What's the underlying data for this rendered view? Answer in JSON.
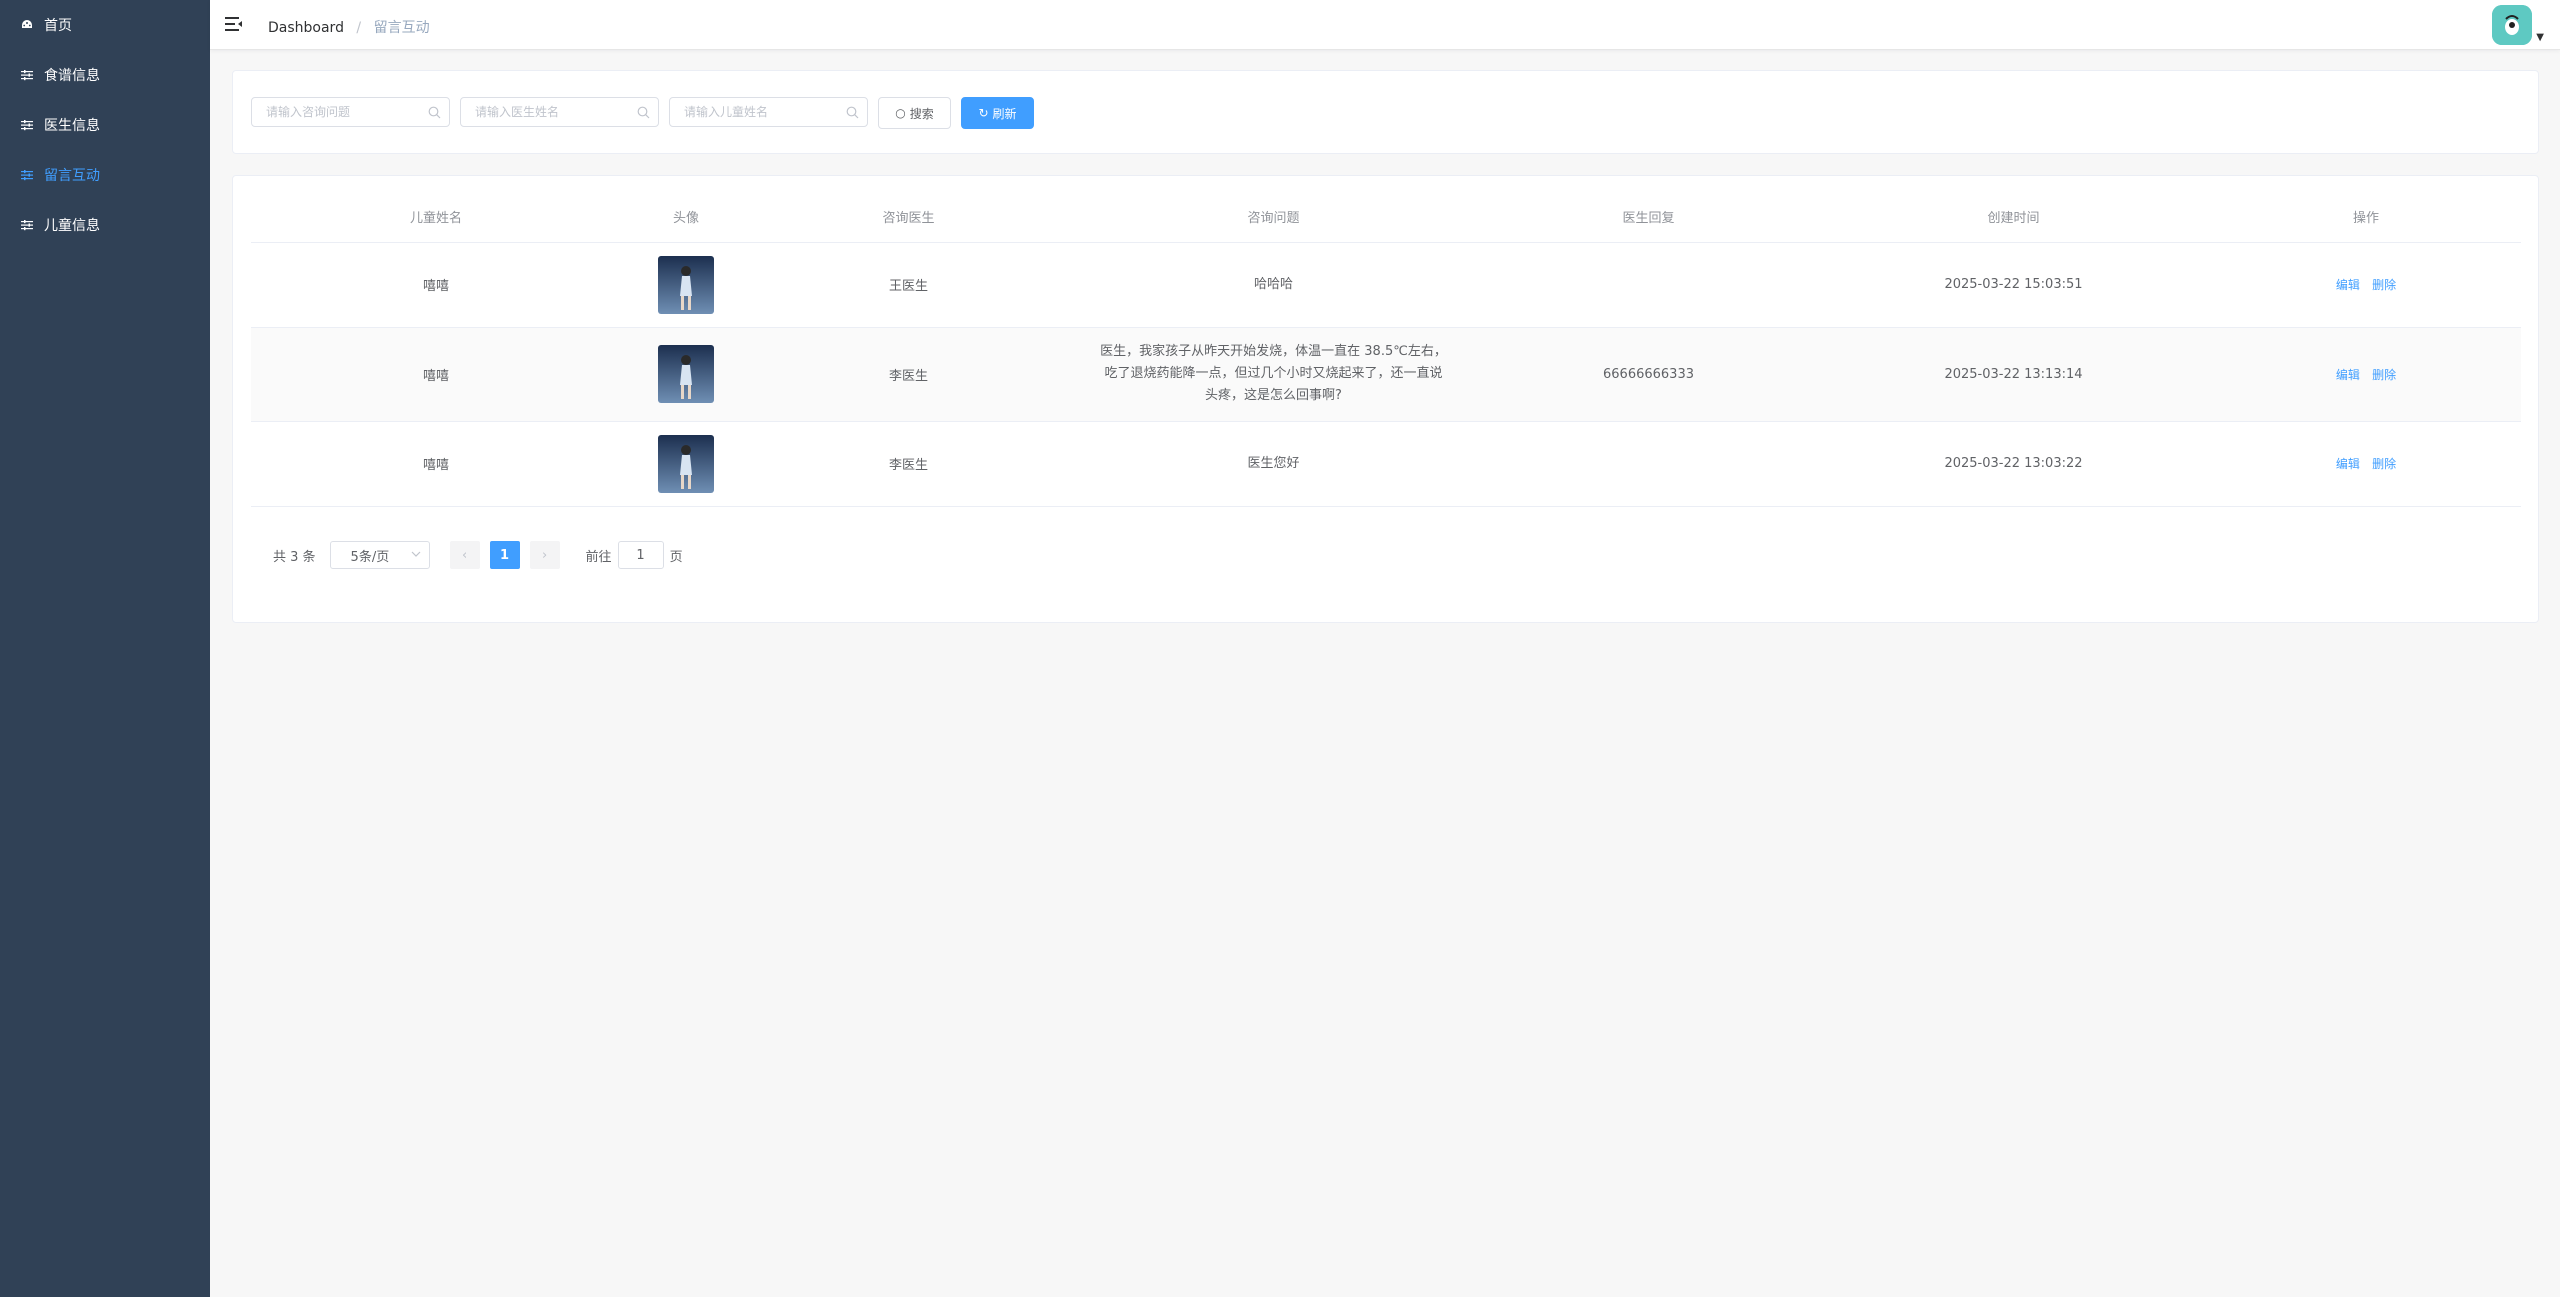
{
  "sidebar": {
    "items": [
      {
        "label": "首页",
        "icon": "dashboard-icon"
      },
      {
        "label": "食谱信息",
        "icon": "sliders-icon"
      },
      {
        "label": "医生信息",
        "icon": "sliders-icon"
      },
      {
        "label": "留言互动",
        "icon": "sliders-icon",
        "active": true
      },
      {
        "label": "儿童信息",
        "icon": "sliders-icon"
      }
    ]
  },
  "header": {
    "breadcrumb": {
      "home": "Dashboard",
      "separator": "/",
      "current": "留言互动"
    }
  },
  "search": {
    "question_placeholder": "请输入咨询问题",
    "doctor_placeholder": "请输入医生姓名",
    "child_placeholder": "请输入儿童姓名",
    "search_label": "搜索",
    "refresh_label": "刷新"
  },
  "table": {
    "headers": [
      "儿童姓名",
      "头像",
      "咨询医生",
      "咨询问题",
      "医生回复",
      "创建时间",
      "操作"
    ],
    "rows": [
      {
        "child": "嘻嘻",
        "doctor": "王医生",
        "question": "哈哈哈",
        "reply": "",
        "created": "2025-03-22 15:03:51",
        "edit": "编辑",
        "delete": "删除"
      },
      {
        "child": "嘻嘻",
        "doctor": "李医生",
        "question": "医生，我家孩子从昨天开始发烧，体温一直在 38.5℃左右，吃了退烧药能降一点，但过几个小时又烧起来了，还一直说头疼，这是怎么回事啊?",
        "reply": "66666666333",
        "created": "2025-03-22 13:13:14",
        "edit": "编辑",
        "delete": "删除"
      },
      {
        "child": "嘻嘻",
        "doctor": "李医生",
        "question": "医生您好",
        "reply": "",
        "created": "2025-03-22 13:03:22",
        "edit": "编辑",
        "delete": "删除"
      }
    ]
  },
  "pagination": {
    "total": "共 3 条",
    "page_size": "5条/页",
    "current_page": "1",
    "goto_prefix": "前往",
    "goto_value": "1",
    "goto_suffix": "页",
    "prev": "‹",
    "next": "›"
  },
  "colors": {
    "sidebar_bg": "#304156",
    "accent": "#409eff",
    "active_text": "#409eff"
  }
}
